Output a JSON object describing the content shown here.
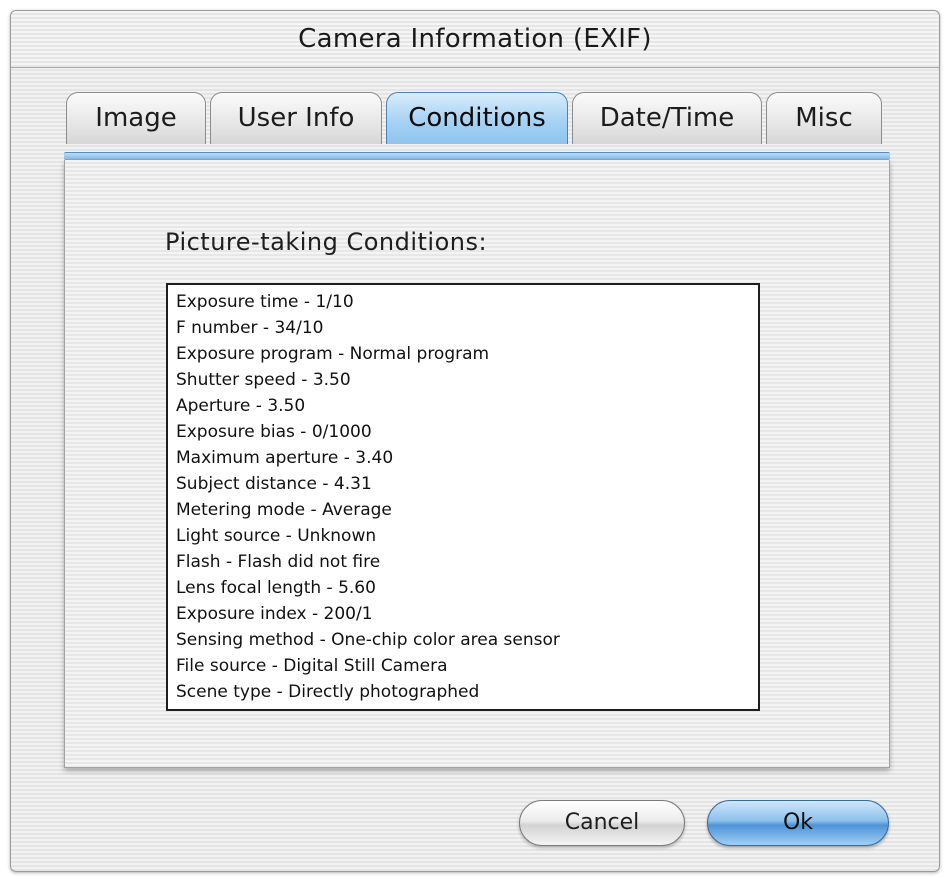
{
  "window": {
    "title": "Camera Information (EXIF)"
  },
  "tabs": [
    {
      "label": "Image"
    },
    {
      "label": "User Info"
    },
    {
      "label": "Conditions",
      "active": true
    },
    {
      "label": "Date/Time"
    },
    {
      "label": "Misc"
    }
  ],
  "panel": {
    "heading": "Picture-taking Conditions:",
    "conditions": [
      "Exposure time  - 1/10",
      "F number  - 34/10",
      "Exposure program  - Normal program",
      "Shutter speed  - 3.50",
      "Aperture  - 3.50",
      "Exposure bias  - 0/1000",
      "Maximum aperture  - 3.40",
      "Subject distance  - 4.31",
      "Metering mode  - Average",
      "Light source  - Unknown",
      "Flash  - Flash did not fire",
      "Lens focal length  - 5.60",
      "Exposure index  - 200/1",
      "Sensing method  - One-chip color area sensor",
      "File source  - Digital Still Camera",
      "Scene type  - Directly photographed"
    ]
  },
  "buttons": {
    "cancel_label": "Cancel",
    "ok_label": "Ok"
  },
  "colors": {
    "accent": "#8ec4ee",
    "default_button": "#4e93d6"
  }
}
